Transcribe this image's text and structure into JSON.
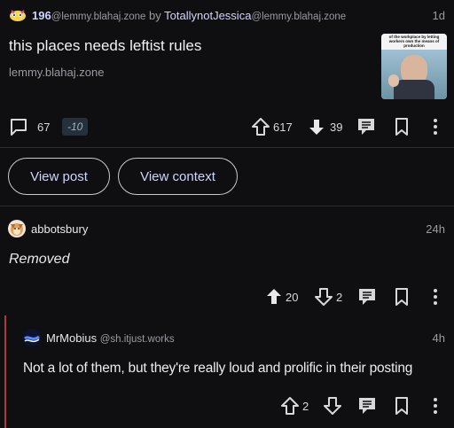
{
  "post": {
    "community_count": "196",
    "community_host": "@lemmy.blahaj.zone",
    "by": "by",
    "author": "TotallynotJessica",
    "author_host": "@lemmy.blahaj.zone",
    "age": "1d",
    "title": "this places needs leftist rules",
    "domain": "lemmy.blahaj.zone",
    "thumbnail_caption": "of the workplace by letting workers own the means of production",
    "comments": "67",
    "score_delta": "-10",
    "upvotes": "617",
    "downvotes": "39"
  },
  "actions": {
    "view_post": "View post",
    "view_context": "View context"
  },
  "comment1": {
    "user": "abbotsbury",
    "age": "24h",
    "body": "Removed",
    "upvotes": "20",
    "downvotes": "2"
  },
  "comment2": {
    "user": "MrMobius",
    "host": "@sh.itjust.works",
    "age": "4h",
    "body": "Not a lot of them, but they're really loud and prolific in their posting",
    "upvotes": "2"
  },
  "colors": {
    "background": "#0f0f12",
    "accent_link": "#cfd4ff",
    "thread_line": "#b03a3a"
  },
  "icons": [
    "community-icon",
    "comment-icon",
    "upvote-icon",
    "downvote-icon",
    "reply-icon",
    "bookmark-icon",
    "more-icon",
    "avatar-dog",
    "avatar-wave"
  ]
}
